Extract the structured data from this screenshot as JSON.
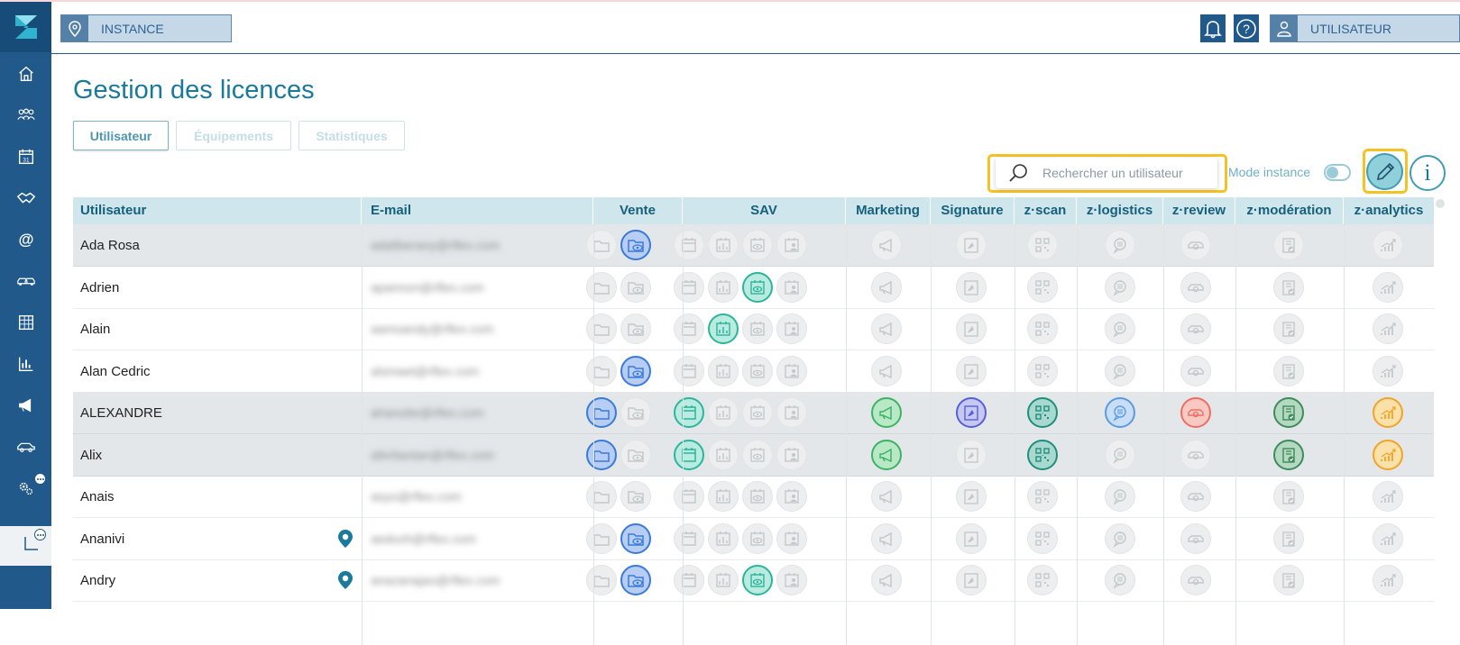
{
  "topbar": {
    "instance_label": "INSTANCE",
    "user_label": "UTILISATEUR"
  },
  "page": {
    "title": "Gestion des licences",
    "tabs": [
      {
        "label": "Utilisateur",
        "active": true
      },
      {
        "label": "Équipements",
        "active": false
      },
      {
        "label": "Statistiques",
        "active": false
      }
    ],
    "search_placeholder": "Rechercher un utilisateur",
    "mode_label": "Mode instance",
    "info_label": "i"
  },
  "colors": {
    "sidebar": "#20598a",
    "accent": "#1b7a9c",
    "header_bg": "#cfe6ec",
    "highlight": "#f5c224",
    "vente": "#3a7bd5",
    "sav": "#2db59b",
    "marketing": "#3cb464",
    "signature": "#5860d6",
    "zscan": "#1e8f7c",
    "zlogistics": "#5c9ae0",
    "zreview": "#ee6f61",
    "zmoderation": "#3d8c5a",
    "zanalytics": "#f0a528"
  },
  "table": {
    "columns": [
      {
        "key": "user",
        "label": "Utilisateur"
      },
      {
        "key": "email",
        "label": "E-mail"
      },
      {
        "key": "vente",
        "label": "Vente"
      },
      {
        "key": "sav",
        "label": "SAV"
      },
      {
        "key": "marketing",
        "label": "Marketing"
      },
      {
        "key": "signature",
        "label": "Signature"
      },
      {
        "key": "zscan",
        "label": "z·scan"
      },
      {
        "key": "zlogistics",
        "label": "z·logistics"
      },
      {
        "key": "zreview",
        "label": "z·review"
      },
      {
        "key": "zmoderation",
        "label": "z·modération"
      },
      {
        "key": "zanalytics",
        "label": "z·analytics"
      }
    ],
    "rows": [
      {
        "name": "Ada Rosa",
        "email": "adaliberany@rflex.com",
        "gray": true,
        "pin": false,
        "vente": [
          0,
          1
        ],
        "sav": [
          0,
          0,
          0,
          0
        ],
        "marketing": 0,
        "signature": 0,
        "zscan": 0,
        "zlogistics": 0,
        "zreview": 0,
        "zmoderation": 0,
        "zanalytics": 0
      },
      {
        "name": "Adrien",
        "email": "apannon@rflex.com",
        "gray": false,
        "pin": false,
        "vente": [
          0,
          0
        ],
        "sav": [
          0,
          0,
          1,
          0
        ],
        "marketing": 0,
        "signature": 0,
        "zscan": 0,
        "zlogistics": 0,
        "zreview": 0,
        "zmoderation": 0,
        "zanalytics": 0
      },
      {
        "name": "Alain",
        "email": "aamoandy@rflex.com",
        "gray": false,
        "pin": false,
        "vente": [
          0,
          0
        ],
        "sav": [
          0,
          1,
          0,
          0
        ],
        "marketing": 0,
        "signature": 0,
        "zscan": 0,
        "zlogistics": 0,
        "zreview": 0,
        "zmoderation": 0,
        "zanalytics": 0
      },
      {
        "name": "Alan Cedric",
        "email": "alsmaet@rflex.com",
        "gray": false,
        "pin": false,
        "vente": [
          0,
          1
        ],
        "sav": [
          0,
          0,
          0,
          0
        ],
        "marketing": 0,
        "signature": 0,
        "zscan": 0,
        "zlogistics": 0,
        "zreview": 0,
        "zmoderation": 0,
        "zanalytics": 0
      },
      {
        "name": "ALEXANDRE",
        "email": "ahanotte@rflex.com",
        "gray": true,
        "pin": false,
        "vente": [
          1,
          0
        ],
        "sav": [
          1,
          0,
          0,
          0
        ],
        "marketing": 1,
        "signature": 1,
        "zscan": 1,
        "zlogistics": 1,
        "zreview": 1,
        "zmoderation": 1,
        "zanalytics": 1
      },
      {
        "name": "Alix",
        "email": "afertiantan@rflex.com",
        "gray": true,
        "pin": false,
        "vente": [
          1,
          0
        ],
        "sav": [
          1,
          0,
          0,
          0
        ],
        "marketing": 1,
        "signature": 0,
        "zscan": 1,
        "zlogistics": 0,
        "zreview": 0,
        "zmoderation": 1,
        "zanalytics": 1
      },
      {
        "name": "Anais",
        "email": "asyo@rflex.com",
        "gray": false,
        "pin": false,
        "vente": [
          0,
          0
        ],
        "sav": [
          0,
          0,
          0,
          0
        ],
        "marketing": 0,
        "signature": 0,
        "zscan": 0,
        "zlogistics": 0,
        "zreview": 0,
        "zmoderation": 0,
        "zanalytics": 0
      },
      {
        "name": "Ananivi",
        "email": "aeduvh@rflex.com",
        "gray": false,
        "pin": true,
        "vente": [
          0,
          1
        ],
        "sav": [
          0,
          0,
          0,
          0
        ],
        "marketing": 0,
        "signature": 0,
        "zscan": 0,
        "zlogistics": 0,
        "zreview": 0,
        "zmoderation": 0,
        "zanalytics": 0
      },
      {
        "name": "Andry",
        "email": "anazanajao@rflex.com",
        "gray": false,
        "pin": true,
        "vente": [
          0,
          1
        ],
        "sav": [
          0,
          0,
          1,
          0
        ],
        "marketing": 0,
        "signature": 0,
        "zscan": 0,
        "zlogistics": 0,
        "zreview": 0,
        "zmoderation": 0,
        "zanalytics": 0
      }
    ]
  }
}
